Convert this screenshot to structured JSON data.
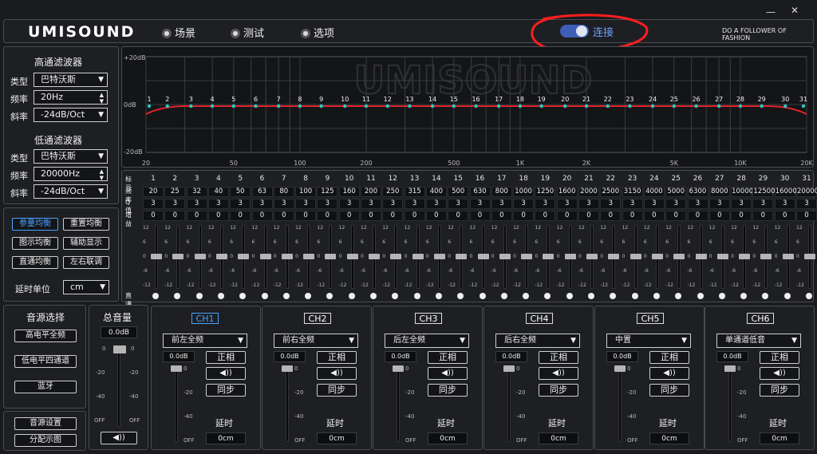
{
  "window": {
    "minimize": "—",
    "close": "✕"
  },
  "header": {
    "logo": "UMISOUND",
    "nav": [
      "场景",
      "测试",
      "选项"
    ],
    "connect": "连接",
    "tagline": "DO A FOLLOWER OF FASHION"
  },
  "highpass": {
    "title": "高通滤波器",
    "type_label": "类型",
    "type": "巴特沃斯",
    "freq_label": "频率",
    "freq": "20Hz",
    "slope_label": "斜率",
    "slope": "-24dB/Oct"
  },
  "lowpass": {
    "title": "低通滤波器",
    "type_label": "类型",
    "type": "巴特沃斯",
    "freq_label": "频率",
    "freq": "20000Hz",
    "slope_label": "斜率",
    "slope": "-24dB/Oct"
  },
  "eq_buttons": [
    "参量均衡",
    "重置均衡",
    "图示均衡",
    "辅助显示",
    "直通均衡",
    "左右联调"
  ],
  "delay_unit": {
    "label": "延时单位",
    "value": "cm"
  },
  "graph": {
    "y_labels": [
      "+20dB",
      "0dB",
      "-20dB"
    ],
    "x_labels": [
      "20",
      "50",
      "100",
      "200",
      "500",
      "1K",
      "2K",
      "5K",
      "10K",
      "20K"
    ],
    "watermark": "UMISOUND"
  },
  "eq_table": {
    "row_labels": [
      "标号",
      "频率",
      "Q值",
      "增益"
    ],
    "bands": [
      "1",
      "2",
      "3",
      "4",
      "5",
      "6",
      "7",
      "8",
      "9",
      "10",
      "11",
      "12",
      "13",
      "14",
      "15",
      "16",
      "17",
      "18",
      "19",
      "20",
      "21",
      "22",
      "23",
      "24",
      "25",
      "26",
      "27",
      "28",
      "29",
      "30",
      "31"
    ],
    "freqs": [
      "20",
      "25",
      "32",
      "40",
      "50",
      "63",
      "80",
      "100",
      "125",
      "160",
      "200",
      "250",
      "315",
      "400",
      "500",
      "630",
      "800",
      "1000",
      "1250",
      "1600",
      "2000",
      "2500",
      "3150",
      "4000",
      "5000",
      "6300",
      "8000",
      "10000",
      "12500",
      "16000",
      "20000"
    ],
    "q": "3",
    "gain": "0",
    "fader_scale": [
      "12",
      "6",
      "0",
      "-6",
      "-12"
    ],
    "bypass_label": "直通"
  },
  "source": {
    "title": "音源选择",
    "options": [
      "高电平全频",
      "低电平四通道",
      "蓝牙"
    ],
    "settings": "音源设置",
    "routing": "分配示图"
  },
  "master": {
    "title": "总音量",
    "value": "0.0dB",
    "scale": [
      "0",
      "-20",
      "-40",
      "OFF"
    ]
  },
  "channels": [
    {
      "name": "CH1",
      "source": "前左全频",
      "value": "0.0dB",
      "delay": "0cm"
    },
    {
      "name": "CH2",
      "source": "前右全频",
      "value": "0.0dB",
      "delay": "0cm"
    },
    {
      "name": "CH3",
      "source": "后左全频",
      "value": "0.0dB",
      "delay": "0cm"
    },
    {
      "name": "CH4",
      "source": "后右全频",
      "value": "0.0dB",
      "delay": "0cm"
    },
    {
      "name": "CH5",
      "source": "中置",
      "value": "0.0dB",
      "delay": "0cm"
    },
    {
      "name": "CH6",
      "source": "单通道低音",
      "value": "0.0dB",
      "delay": "0cm"
    }
  ],
  "channel_labels": {
    "phase": "正相",
    "sync": "同步",
    "delay": "延时"
  },
  "channel_scale": [
    "0",
    "-20",
    "-40",
    "OFF"
  ],
  "colors": {
    "accent": "#4aa3ff",
    "curve": "#e0242a",
    "point": "#2fc9c0",
    "annotation": "#ff1e1e"
  }
}
